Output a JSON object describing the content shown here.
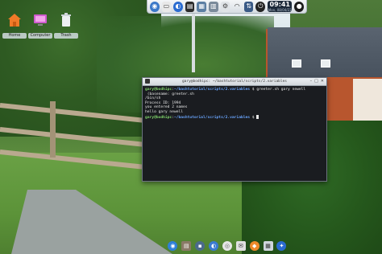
{
  "desktop": {
    "icons": [
      {
        "label": "Home"
      },
      {
        "label": "Computer"
      },
      {
        "label": "Trash"
      }
    ]
  },
  "topdock": {
    "clock": {
      "time": "09:41",
      "date": "Mon, 08/04/23"
    },
    "icons": [
      "app-menu-icon",
      "files-icon",
      "browser-icon",
      "terminal-icon",
      "image-viewer-icon",
      "photos-icon",
      "settings-icon",
      "wifi-icon",
      "network-icon",
      "power-icon",
      "clock-widget",
      "avatar-icon",
      "lock-icon"
    ]
  },
  "terminal": {
    "title": "gary@bodhipc: ~/bashtutorial/scripts/2.variables",
    "lines": [
      {
        "user": "gary@bodhipc",
        "path": "~/bashtutorial/scripts/2.variables",
        "cmd": " $ greeter.sh gary newell"
      },
      {
        "text": " (basename: greeter.sh"
      },
      {
        "text": "/bin/sh"
      },
      {
        "text": "Process ID: 1994"
      },
      {
        "text": ""
      },
      {
        "text": "you entered 2 names"
      },
      {
        "text": "hello gary newell"
      },
      {
        "user": "gary@bodhipc",
        "path": "~/bashtutorial/scripts/2.variables",
        "cmd": " $ "
      }
    ]
  },
  "botdock": {
    "icons": [
      "chrome-icon",
      "files-icon",
      "terminal-icon",
      "browser-icon",
      "disc-icon",
      "mail-icon",
      "paint-icon",
      "network-icon",
      "settings-icon"
    ]
  }
}
